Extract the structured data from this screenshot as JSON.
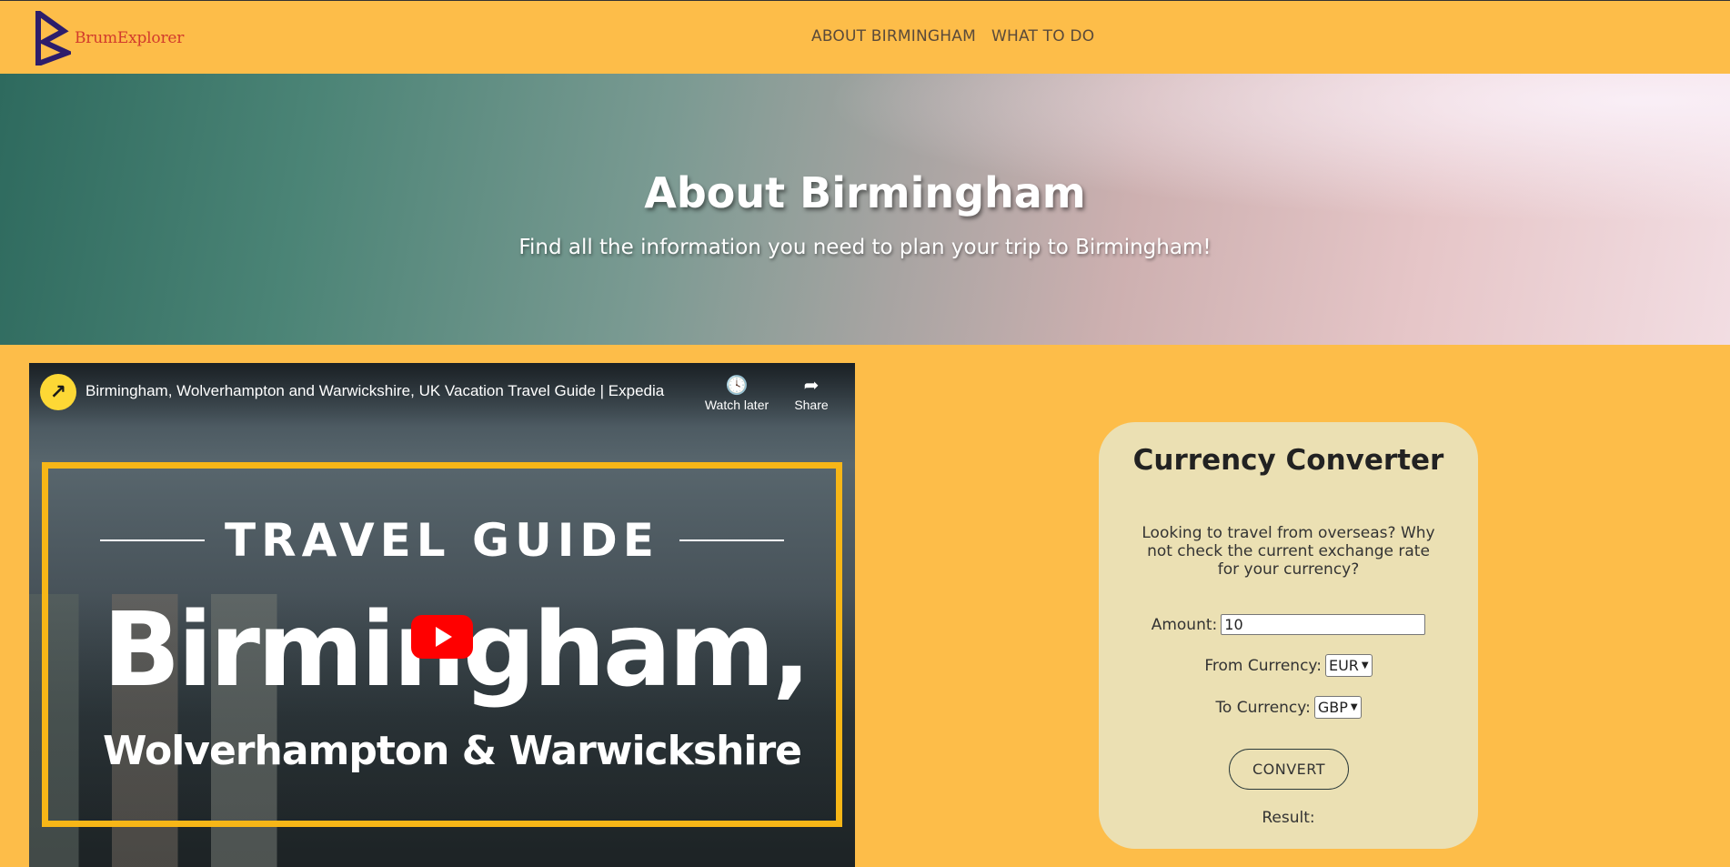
{
  "brand": {
    "name": "BrumExplorer",
    "accent": "#d23b2c",
    "logo_color": "#2d1d6b"
  },
  "nav": {
    "items": [
      {
        "label": "ABOUT BIRMINGHAM"
      },
      {
        "label": "WHAT TO DO"
      }
    ]
  },
  "hero": {
    "title": "About Birmingham",
    "subtitle": "Find all the information you need to plan your trip to Birmingham!"
  },
  "video": {
    "title": "Birmingham, Wolverhampton and Warwickshire, UK Vacation Travel Guide | Expedia",
    "watch_later_label": "Watch later",
    "share_label": "Share",
    "thumb_heading": "TRAVEL GUIDE",
    "thumb_city": "Birmingham,",
    "thumb_sub": "Wolverhampton & Warwickshire",
    "icons": [
      "expedia-logo-icon",
      "clock-icon",
      "share-icon",
      "youtube-play-icon"
    ]
  },
  "converter": {
    "title": "Currency Converter",
    "description": "Looking to travel from overseas? Why not check the current exchange rate for your currency?",
    "amount_label": "Amount:",
    "amount_value": "10",
    "from_label": "From Currency:",
    "from_value": "EUR",
    "to_label": "To Currency:",
    "to_value": "GBP",
    "convert_label": "CONVERT",
    "result_label": "Result:"
  },
  "colors": {
    "page_bg": "#fdbd49",
    "card_bg": "#ebe0b3",
    "frame": "#f7b617",
    "play": "#ff0000"
  }
}
